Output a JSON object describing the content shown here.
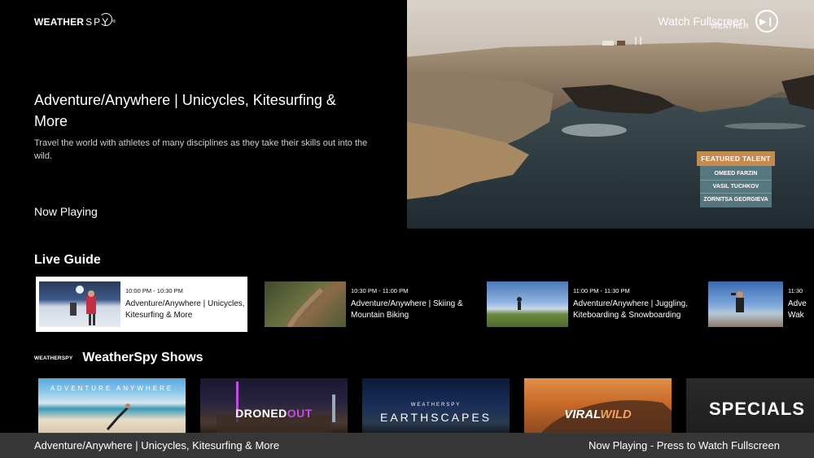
{
  "brand": {
    "weather": "WEATHER",
    "spy": "SPY",
    "reg": "®"
  },
  "hero": {
    "title": "Adventure/Anywhere | Unicycles, Kitesurfing & More",
    "description": "Travel the world with athletes of many disciplines as they take their skills out into the wild.",
    "status": "Now Playing"
  },
  "video": {
    "watch_fullscreen": "Watch Fullscreen",
    "watermark": "WEATHER",
    "playpause_icon": "play-pause-icon",
    "featured_talent": {
      "heading": "FEATURED TALENT",
      "names": [
        "OMEED FARZIN",
        "VASIL TUCHKOV",
        "ZORNITSA GEORGIEVA"
      ]
    }
  },
  "live_guide": {
    "title": "Live Guide",
    "items": [
      {
        "time": "10:00 PM - 10:30 PM",
        "name": "Adventure/Anywhere | Unicycles, Kitesurfing & More"
      },
      {
        "time": "10:30 PM - 11:00 PM",
        "name": "Adventure/Anywhere | Skiing & Mountain Biking"
      },
      {
        "time": "11:00 PM - 11:30 PM",
        "name": "Adventure/Anywhere | Juggling, Kiteboarding & Snowboarding"
      },
      {
        "time": "11:30",
        "name": "Adve Wak"
      }
    ]
  },
  "shows": {
    "logo": "WEATHERSPY",
    "title": "WeatherSpy Shows",
    "items": [
      {
        "label": "ADVENTURE ANYWHERE"
      },
      {
        "label_a": "DRONED",
        "label_b": "OUT"
      },
      {
        "label_top": "WEATHERSPY",
        "label": "EARTHSCAPES"
      },
      {
        "label_a": "VIRAL",
        "label_b": "WILD"
      },
      {
        "label": "SPECIALS"
      }
    ]
  },
  "bottom_bar": {
    "left": "Adventure/Anywhere | Unicycles, Kitesurfing & More",
    "right": "Now Playing - Press to Watch Fullscreen"
  },
  "colors": {
    "talent_header": "#c58a4d",
    "talent_list": "#5f828c",
    "bottom_bar": "#3c3c3c",
    "dronedout_accent": "#c04ee0",
    "viralwild_accent": "#f0a060"
  }
}
